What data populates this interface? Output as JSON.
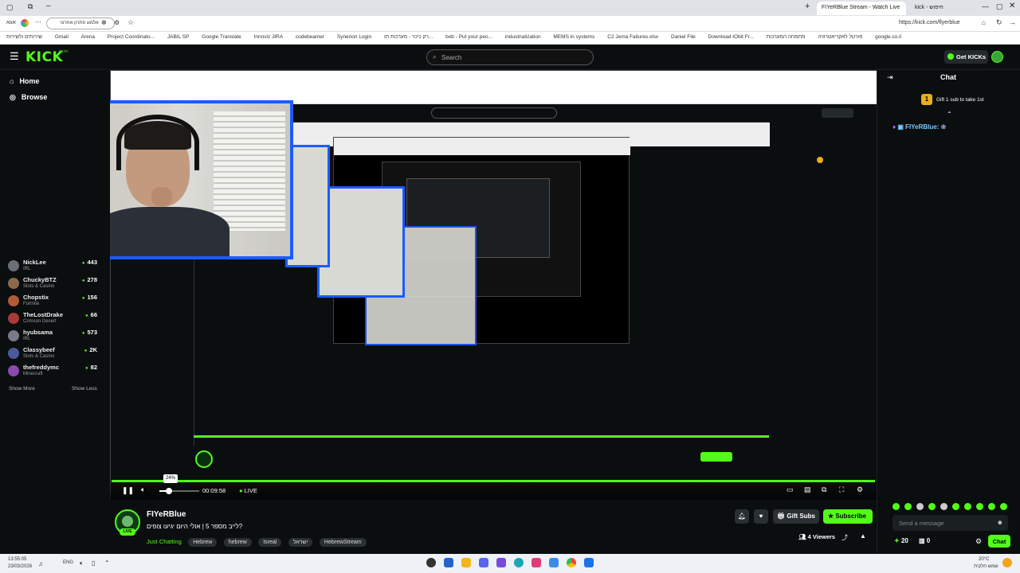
{
  "browser": {
    "tabs": [
      {
        "label": "FIYeRBlue Stream - Watch Live",
        "active": true
      },
      {
        "label": "kick - חיפוש",
        "active": false
      }
    ],
    "url": "https://kick.com/flyerblue",
    "profile": "אלמוג פתרון אחרוני",
    "profile_short": "אגא",
    "bookmarks": [
      "שירותים ולשירות",
      "Gmail",
      "Arena",
      "Project Coordinato...",
      "JABIL SP",
      "Google Translate",
      "Innoviz JIRA",
      "codebeamer",
      "Synerion Login",
      "רק כיכר - מערכות תו...",
      "bob - Put your peo...",
      "industrialization",
      "MEMS in systems",
      "C2 Jema Failures.xlsx",
      "Daniel File",
      "Download IObit Fr...",
      "מתמחה המערכות",
      "פורטל לאקריאטרוויה",
      "google.co.il"
    ]
  },
  "header": {
    "logo": "KICK",
    "logo_badge": "BETA",
    "search_placeholder": "Search",
    "get_kicks": "Get KICKs"
  },
  "sidebar": {
    "nav": [
      {
        "label": "Home"
      },
      {
        "label": "Browse"
      }
    ],
    "channels": [
      {
        "name": "NickLee",
        "category": "IRL",
        "viewers": "443",
        "color": "#6a6f78"
      },
      {
        "name": "ChuckyBTZ",
        "category": "Slots & Casino",
        "viewers": "278",
        "color": "#8a6a4a"
      },
      {
        "name": "Chopstix",
        "category": "Fortnite",
        "viewers": "156",
        "color": "#b05a3a"
      },
      {
        "name": "TheLostDrake",
        "category": "Crimson Desert",
        "viewers": "66",
        "color": "#a83a3a"
      },
      {
        "name": "hyubsama",
        "category": "IRL",
        "viewers": "573",
        "color": "#7a7a8a"
      },
      {
        "name": "Classybeef",
        "category": "Slots & Casino",
        "viewers": "2K",
        "color": "#4a5a9a"
      },
      {
        "name": "thefreddymc",
        "category": "Minecraft",
        "viewers": "82",
        "color": "#8a4ab0"
      }
    ],
    "show_more": "Show More",
    "show_less": "Show Less"
  },
  "player": {
    "time": "00:09:58",
    "live_label": "LIVE",
    "volume_tooltip": "24%",
    "volume_level": 0.24
  },
  "stream": {
    "channel": "FIYeRBlue",
    "title": "לייב מספר 5 | אולי היום יגיעו צופים?",
    "category": "Just Chatting",
    "tags": [
      "Hebrew",
      "hebrew",
      "Isreal",
      "ישראל",
      "HebrewStream"
    ],
    "gift_subs": "Gift Subs",
    "subscribe": "Subscribe",
    "viewers": "4 Viewers",
    "live_badge": "LIVE"
  },
  "chat": {
    "title": "Chat",
    "gift_prompt": "Gift 1 sub to take 1st",
    "gift_rank": "1",
    "message_user": "FIYeRBlue:",
    "input_placeholder": "Send a message",
    "kicks_count": "20",
    "other_count": "0",
    "send_label": "Chat"
  },
  "taskbar": {
    "time": "13:55:05",
    "date": "23/03/2026",
    "lang": "ENG",
    "weather_temp": "20°C",
    "weather_desc": "שמש חלקית"
  }
}
